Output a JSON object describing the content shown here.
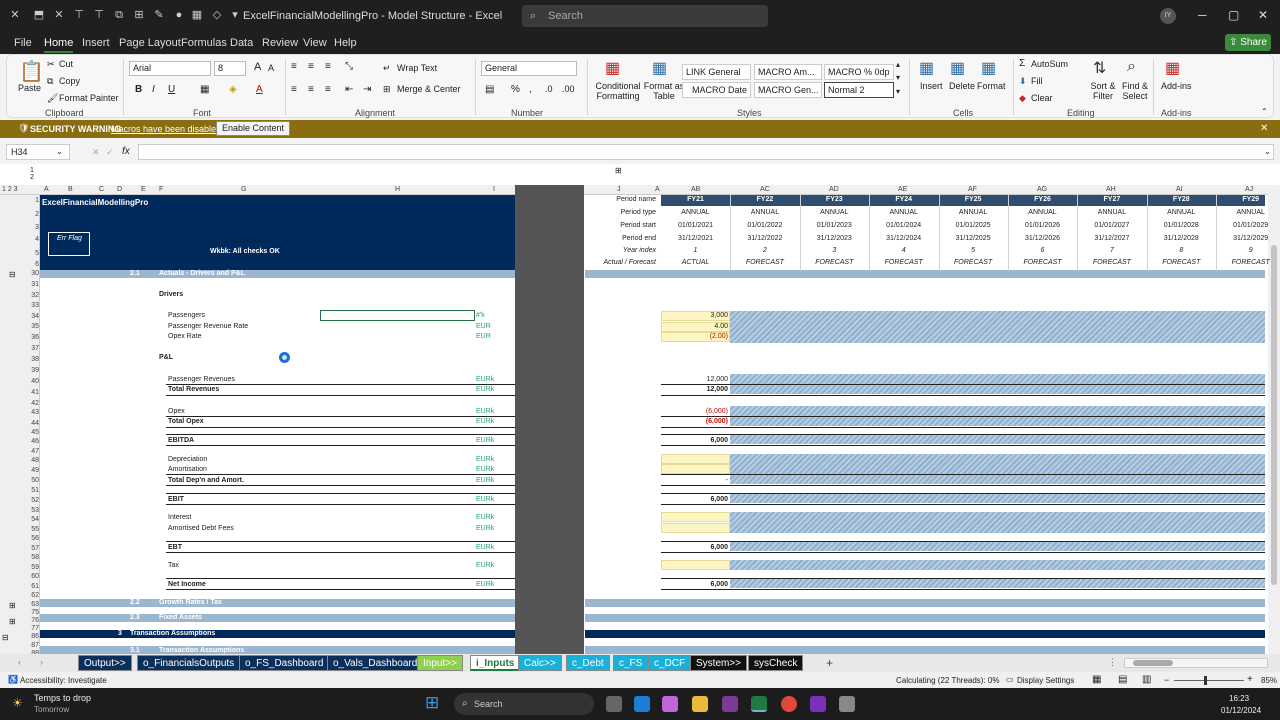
{
  "titlebar": {
    "title": "ExcelFinancialModellingPro - Model Structure - Excel",
    "search_placeholder": "Search",
    "avatar": "IY"
  },
  "tabs": [
    "File",
    "Home",
    "Insert",
    "Page Layout",
    "Formulas",
    "Data",
    "Review",
    "View",
    "Help"
  ],
  "share_label": "Share",
  "ribbon": {
    "paste": "Paste",
    "cut": "Cut",
    "copy": "Copy",
    "format_painter": "Format Painter",
    "font_name": "Arial",
    "font_size": "8",
    "wrap_text": "Wrap Text",
    "merge_center": "Merge & Center",
    "number_format": "General",
    "cond_format": "Conditional Formatting",
    "format_table": "Format as Table",
    "styles": [
      "LINK General",
      "MACRO Am...",
      "MACRO % 0dp",
      "MACRO Date",
      "MACRO Gen...",
      "Normal 2"
    ],
    "insert": "Insert",
    "delete": "Delete",
    "format": "Format",
    "autosum": "AutoSum",
    "fill": "Fill",
    "clear": "Clear",
    "sort_filter": "Sort & Filter",
    "find_select": "Find & Select",
    "addins": "Add-ins",
    "groups": [
      "Clipboard",
      "Font",
      "Alignment",
      "Number",
      "Styles",
      "Cells",
      "Editing",
      "Add-ins"
    ]
  },
  "security": {
    "title": "SECURITY WARNING",
    "message": "Macros have been disabled.",
    "button": "Enable Content"
  },
  "namebox": "H34",
  "sheet": {
    "model_title": "ExcelFinancialModellingPro",
    "err_flag": "Err Flag",
    "checks": "Wkbk: All checks OK",
    "period_labels": [
      "Period name",
      "Period type",
      "Period start",
      "Period end",
      "Year index",
      "Actual / Forecast"
    ],
    "periods": [
      {
        "name": "FY21",
        "type": "ANNUAL",
        "start": "01/01/2021",
        "end": "31/12/2021",
        "index": "1",
        "af": "ACTUAL"
      },
      {
        "name": "FY22",
        "type": "ANNUAL",
        "start": "01/01/2022",
        "end": "31/12/2022",
        "index": "2",
        "af": "FORECAST"
      },
      {
        "name": "FY23",
        "type": "ANNUAL",
        "start": "01/01/2023",
        "end": "31/12/2023",
        "index": "3",
        "af": "FORECAST"
      },
      {
        "name": "FY24",
        "type": "ANNUAL",
        "start": "01/01/2024",
        "end": "31/12/2024",
        "index": "4",
        "af": "FORECAST"
      },
      {
        "name": "FY25",
        "type": "ANNUAL",
        "start": "01/01/2025",
        "end": "31/12/2025",
        "index": "5",
        "af": "FORECAST"
      },
      {
        "name": "FY26",
        "type": "ANNUAL",
        "start": "01/01/2026",
        "end": "31/12/2026",
        "index": "6",
        "af": "FORECAST"
      },
      {
        "name": "FY27",
        "type": "ANNUAL",
        "start": "01/01/2027",
        "end": "31/12/2027",
        "index": "7",
        "af": "FORECAST"
      },
      {
        "name": "FY28",
        "type": "ANNUAL",
        "start": "01/01/2028",
        "end": "31/12/2028",
        "index": "8",
        "af": "FORECAST"
      },
      {
        "name": "FY29",
        "type": "ANNUAL",
        "start": "01/01/2029",
        "end": "31/12/2029",
        "index": "9",
        "af": "FORECAST"
      }
    ],
    "section_actuals": {
      "num": "2.1",
      "label": "Actuals - Drivers and P&L"
    },
    "drivers_heading": "Drivers",
    "pl_heading": "P&L",
    "lines": {
      "passengers": {
        "label": "Passengers",
        "unit": "#'k",
        "value": "3,000"
      },
      "pass_rev_rate": {
        "label": "Passenger Revenue Rate",
        "unit": "EUR",
        "value": "4.00"
      },
      "opex_rate": {
        "label": "Opex Rate",
        "unit": "EUR",
        "value": "(2.00)"
      },
      "pass_rev": {
        "label": "Passenger Revenues",
        "unit": "EURk",
        "value": "12,000"
      },
      "total_rev": {
        "label": "Total Revenues",
        "unit": "EURk",
        "value": "12,000"
      },
      "opex": {
        "label": "Opex",
        "unit": "EURk",
        "value": "(6,000)"
      },
      "total_opex": {
        "label": "Total Opex",
        "unit": "EURk",
        "value": "(6,000)"
      },
      "ebitda": {
        "label": "EBITDA",
        "unit": "EURk",
        "value": "6,000"
      },
      "depreciation": {
        "label": "Depreciation",
        "unit": "EURk"
      },
      "amortisation": {
        "label": "Amortisation",
        "unit": "EURk"
      },
      "total_dep": {
        "label": "Total Dep'n and Amort.",
        "unit": "EURk",
        "value": "-"
      },
      "ebit": {
        "label": "EBIT",
        "unit": "EURk",
        "value": "6,000"
      },
      "interest": {
        "label": "Interest",
        "unit": "EURk"
      },
      "amort_debt": {
        "label": "Amortised Debt Fees",
        "unit": "EURk"
      },
      "ebt": {
        "label": "EBT",
        "unit": "EURk",
        "value": "6,000"
      },
      "tax": {
        "label": "Tax",
        "unit": "EURk"
      },
      "net_income": {
        "label": "Net Income",
        "unit": "EURk",
        "value": "6,000"
      }
    },
    "section_growth": {
      "num": "2.2",
      "label": "Growth Rates / Tax"
    },
    "section_fixed": {
      "num": "2.3",
      "label": "Fixed Assets"
    },
    "section_trans": {
      "num": "3",
      "label": "Transaction Assumptions"
    },
    "section_trans2": {
      "num": "3.1",
      "label": "Transaction Assumptions"
    }
  },
  "sheet_tabs": [
    {
      "name": "Output>>",
      "color": "#0b2f5c"
    },
    {
      "name": "o_FinancialsOutputs",
      "color": "#0b2f5c"
    },
    {
      "name": "o_FS_Dashboard",
      "color": "#0b2f5c"
    },
    {
      "name": "o_Vals_Dashboard",
      "color": "#0b2f5c"
    },
    {
      "name": "Input>>",
      "color": "#8fd14f"
    },
    {
      "name": "i_Inputs",
      "color": "#ffffff"
    },
    {
      "name": "Calc>>",
      "color": "#1ab0d8"
    },
    {
      "name": "c_Debt",
      "color": "#1ab0d8"
    },
    {
      "name": "c_FS",
      "color": "#1ab0d8"
    },
    {
      "name": "c_DCF",
      "color": "#1ab0d8"
    },
    {
      "name": "System>>",
      "color": "#111111"
    },
    {
      "name": "sysCheck",
      "color": "#111111"
    }
  ],
  "status": {
    "accessibility": "Accessibility: Investigate",
    "calc": "Calculating (22 Threads): 0%",
    "display": "Display Settings",
    "zoom": "85%"
  },
  "taskbar": {
    "weather_title": "Temps to drop",
    "weather_sub": "Tomorrow",
    "search": "Search",
    "time": "16:23",
    "date": "01/12/2024"
  }
}
